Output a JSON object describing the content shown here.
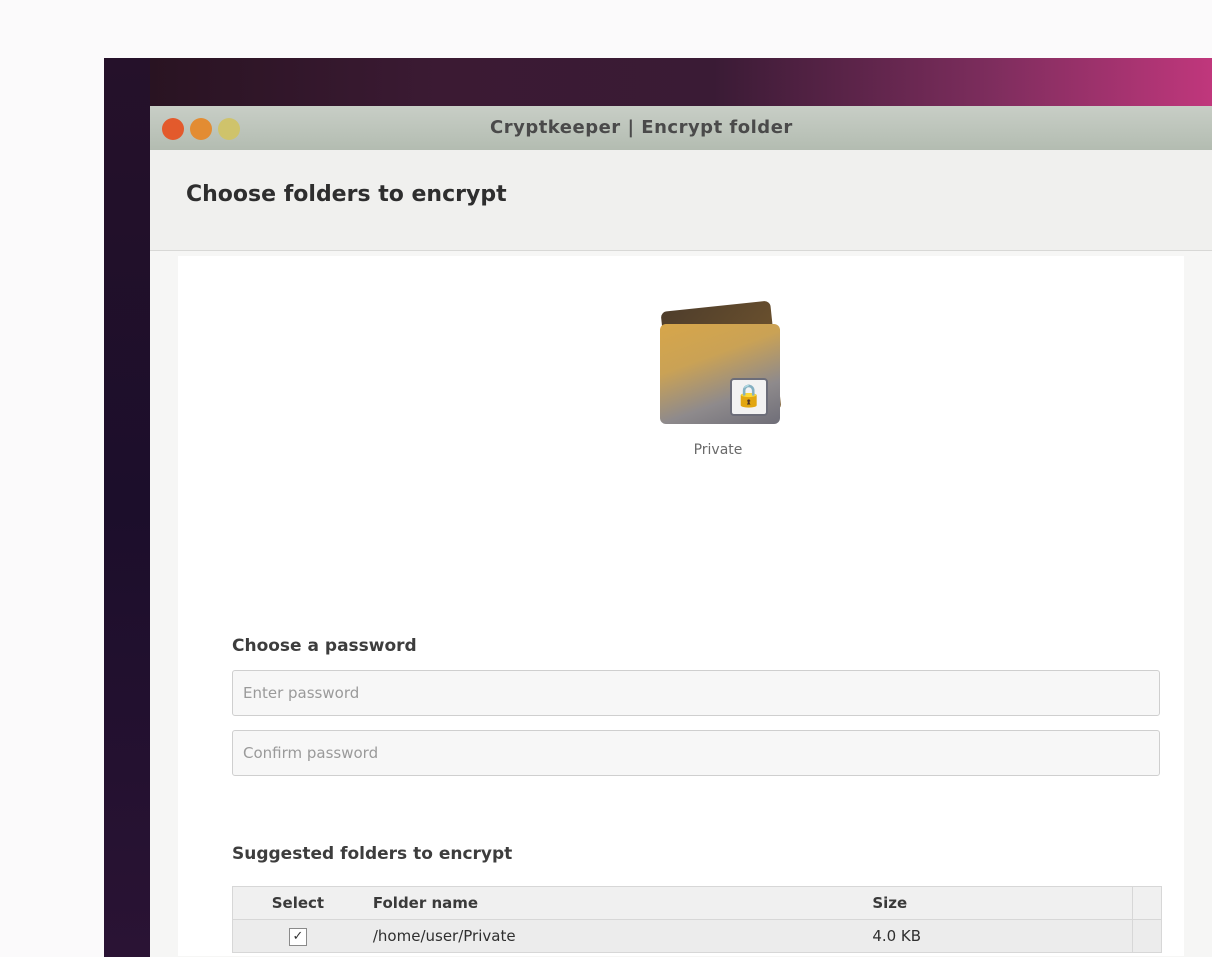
{
  "window": {
    "title": "Cryptkeeper | Encrypt folder"
  },
  "header": {
    "title": "Choose folders to encrypt"
  },
  "folder": {
    "label": "Private",
    "icon": "folder-lock-icon"
  },
  "password": {
    "section_label": "Choose a password",
    "new_placeholder": "Enter password",
    "confirm_placeholder": "Confirm password"
  },
  "suggestions": {
    "section_label": "Suggested folders to encrypt",
    "columns": [
      "Select",
      "Folder name",
      "Size"
    ],
    "rows": [
      {
        "selected": true,
        "checkmark": "✓",
        "name": "/home/user/Private",
        "size": "4.0 KB"
      }
    ]
  },
  "colors": {
    "titlebar": "#b9c1b7",
    "frame_dark": "#26121f",
    "frame_accent": "#c0377c"
  }
}
